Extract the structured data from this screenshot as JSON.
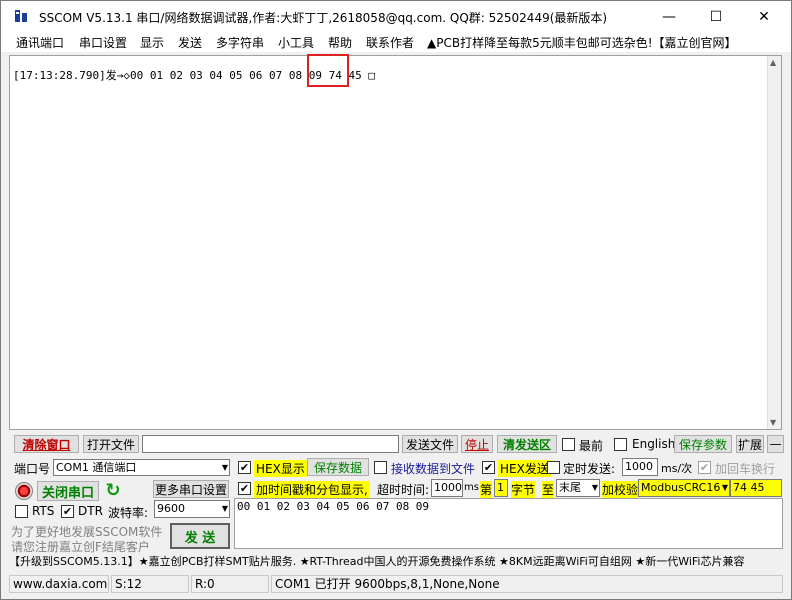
{
  "window": {
    "title": "SSCOM V5.13.1 串口/网络数据调试器,作者:大虾丁丁,2618058@qq.com. QQ群: 52502449(最新版本)",
    "minimize": "—",
    "maximize": "☐",
    "close": "✕"
  },
  "menu": {
    "items": [
      "通讯端口",
      "串口设置",
      "显示",
      "发送",
      "多字符串",
      "小工具",
      "帮助",
      "联系作者"
    ],
    "ad": "▲PCB打样降至每款5元顺丰包邮可选杂色!【嘉立创官网】"
  },
  "receive": {
    "line": "[17:13:28.790]发→◇00 01 02 03 04 05 06 07 08 09 74 45 □"
  },
  "toolbar": {
    "clear_window": "清除窗口",
    "open_file": "打开文件",
    "file_path": "",
    "send_file": "发送文件",
    "stop": "停止",
    "clear_send": "清发送区",
    "topmost": "最前",
    "english": "English",
    "save_params": "保存参数",
    "expand": "扩展",
    "collapse": "—"
  },
  "controls": {
    "port_label": "端口号",
    "port_value": "COM1 通信端口",
    "hex_display": "HEX显示",
    "save_data": "保存数据",
    "recv_to_file": "接收数据到文件",
    "hex_send": "HEX发送",
    "timed_send": "定时发送:",
    "timed_interval": "1000",
    "timed_unit": "ms/次",
    "add_crlf": "加回车换行",
    "close_port": "关闭串口",
    "more_settings": "更多串口设置",
    "add_timestamp": "加时间戳和分包显示,",
    "timeout_label": "超时时间:",
    "timeout_value": "1000",
    "timeout_unit": "ms",
    "byte_prefix": "第",
    "byte_index": "1",
    "byte_suffix": "字节",
    "to_label": "至",
    "to_value": "末尾",
    "checksum_label": "加校验",
    "checksum_value": "ModbusCRC16",
    "checksum_result": "74 45",
    "rts": "RTS",
    "dtr": "DTR",
    "baud_label": "波特率:",
    "baud_value": "9600",
    "send_text": "00 01 02 03 04 05 06 07 08 09",
    "promo_line1": "为了更好地发展SSCOM软件",
    "promo_line2": "请您注册嘉立创F结尾客户",
    "send_button": "发 送"
  },
  "ticker": "【升级到SSCOM5.13.1】★嘉立创PCB打样SMT贴片服务. ★RT-Thread中国人的开源免费操作系统 ★8KM远距离WiFi可自组网 ★新一代WiFi芯片兼容",
  "status": {
    "website": "www.daxia.com",
    "sent": "S:12",
    "received": "R:0",
    "port_state": "COM1 已打开  9600bps,8,1,None,None"
  }
}
